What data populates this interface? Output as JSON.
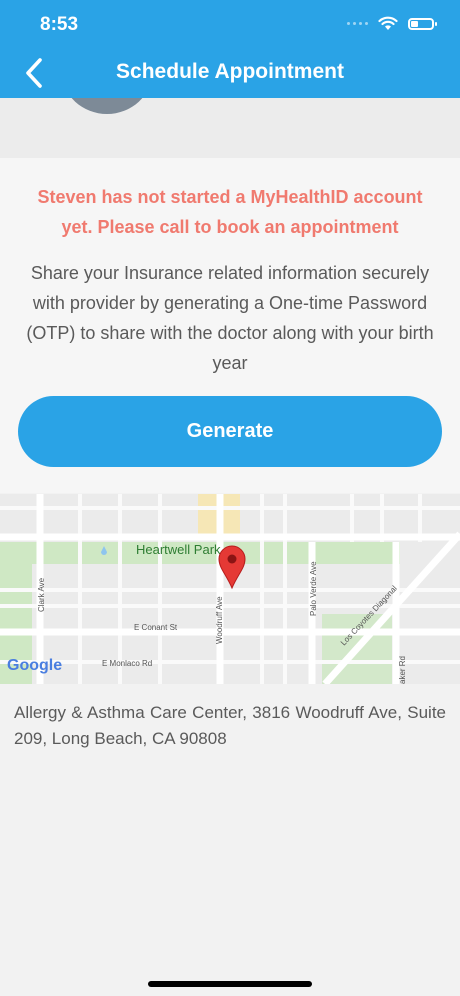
{
  "status_bar": {
    "time": "8:53"
  },
  "header": {
    "title": "Schedule Appointment"
  },
  "notice": {
    "warning": "Steven has not started a MyHealthID account yet. Please call to book an appointment",
    "info": "Share your Insurance related information securely with provider by generating a One-time Password (OTP) to share with the doctor along with your birth year"
  },
  "actions": {
    "generate_label": "Generate"
  },
  "map": {
    "park_label": "Heartwell Park",
    "streets": {
      "clark": "Clark Ave",
      "conant": "E Conant St",
      "woodruff": "Woodruff Ave",
      "palo_verde": "Palo Verde Ave",
      "los_coyotes": "Los Coyotes Diagonal",
      "monlaco": "E Monlaco Rd",
      "baker": "aker Rd"
    },
    "provider_logo": "Google"
  },
  "address": "Allergy & Asthma Care Center, 3816 Woodruff Ave, Suite 209, Long Beach, CA 90808",
  "colors": {
    "accent": "#2aa3e6",
    "warning": "#f07a6f",
    "marker": "#e53935"
  }
}
